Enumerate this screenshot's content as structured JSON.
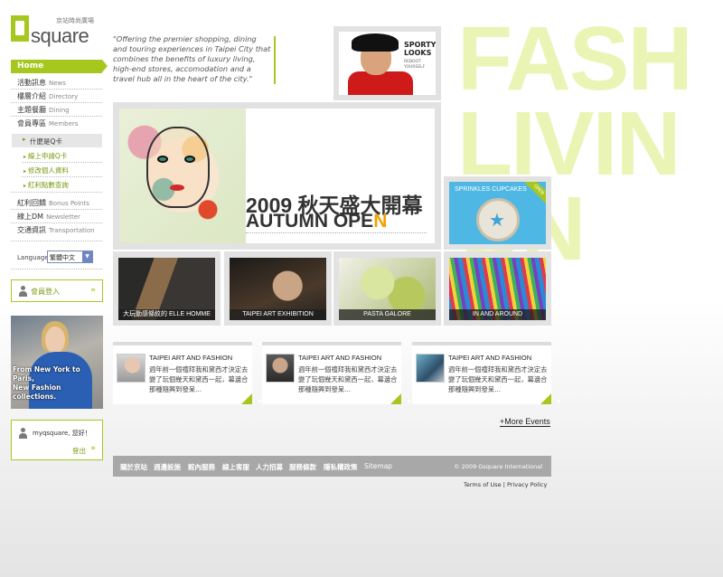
{
  "watermark": [
    "FASH",
    "LIVIN",
    "UN"
  ],
  "logo": {
    "text": "square",
    "sub": "京站時尚廣場"
  },
  "nav": {
    "home": "Home",
    "items": [
      {
        "zh": "活動訊息",
        "en": "News"
      },
      {
        "zh": "樓層介紹",
        "en": "Directory"
      },
      {
        "zh": "主題餐廳",
        "en": "Dining"
      },
      {
        "zh": "會員專區",
        "en": "Members"
      }
    ],
    "sub_head": "什麼是Q卡",
    "sub_items": [
      "線上申請Q卡",
      "修改個人資料",
      "紅利點數查詢"
    ],
    "items2": [
      {
        "zh": "紅利回饋",
        "en": "Bonus Points"
      },
      {
        "zh": "線上DM",
        "en": "Newsletter"
      },
      {
        "zh": "交通資訊",
        "en": "Transportation"
      }
    ]
  },
  "language": {
    "label": "Language",
    "selected": "繁體中文"
  },
  "login": {
    "label": "會員登入"
  },
  "promo": {
    "caption_1": "From New York to Paris,",
    "caption_2": "New Fashion collections."
  },
  "user": {
    "greeting": "myqsquare, 您好！",
    "logout": "登出"
  },
  "quote": "\"Offering the premier shopping, dining and touring experiences in Taipei City that combines the benefits of luxury living, high-end stores, accomodation and a travel hub all in the heart of the city.\"",
  "sporty": {
    "line1": "SPORTY",
    "line2": "LOOKS",
    "line3": "REBOOT",
    "line4": "YOURSELF"
  },
  "banner": {
    "title": "2009 秋天盛大開幕",
    "sub_a": "AUTUMN ",
    "sub_b": "OPE",
    "sub_c": "N"
  },
  "cupcake": {
    "title": "SPRINKLES CUPCAKES",
    "badge": "OPEN"
  },
  "thumbs": [
    {
      "caption": "大玩動感條紋的 ELLE HOMME"
    },
    {
      "caption": "TAIPEI ART EXHIBITION"
    },
    {
      "caption": "PASTA GALORE"
    },
    {
      "caption": "IN AND AROUND"
    }
  ],
  "cards": [
    {
      "title": "TAIPEI ART AND FASHION",
      "body": "週年前一個禮拜我和黛西才決定去變了玩個幾天和黛西一起，幕邊合那種隨興到發呆..."
    },
    {
      "title": "TAIPEI ART AND FASHION",
      "body": "週年前一個禮拜我和黛西才決定去變了玩個幾天和黛西一起，幕邊合那種隨興到發呆..."
    },
    {
      "title": "TAIPEI ART AND FASHION",
      "body": "週年前一個禮拜我和黛西才決定去變了玩個幾天和黛西一起，幕邊合那種隨興到發呆..."
    }
  ],
  "more_events": "+More Events",
  "footer": {
    "links": [
      "關於京站",
      "週邊設施",
      "館內服務",
      "線上客服",
      "人力招募",
      "服務條款",
      "隱私權政策",
      "Sitemap"
    ],
    "copyright": "© 2009 Gsquare International"
  },
  "legal": "Terms of Use | Privacy Policy",
  "colors": {
    "accent": "#a6c81e",
    "accent_dark": "#7a9a10",
    "highlight": "#f5a000",
    "footer": "#a8a8a8"
  }
}
